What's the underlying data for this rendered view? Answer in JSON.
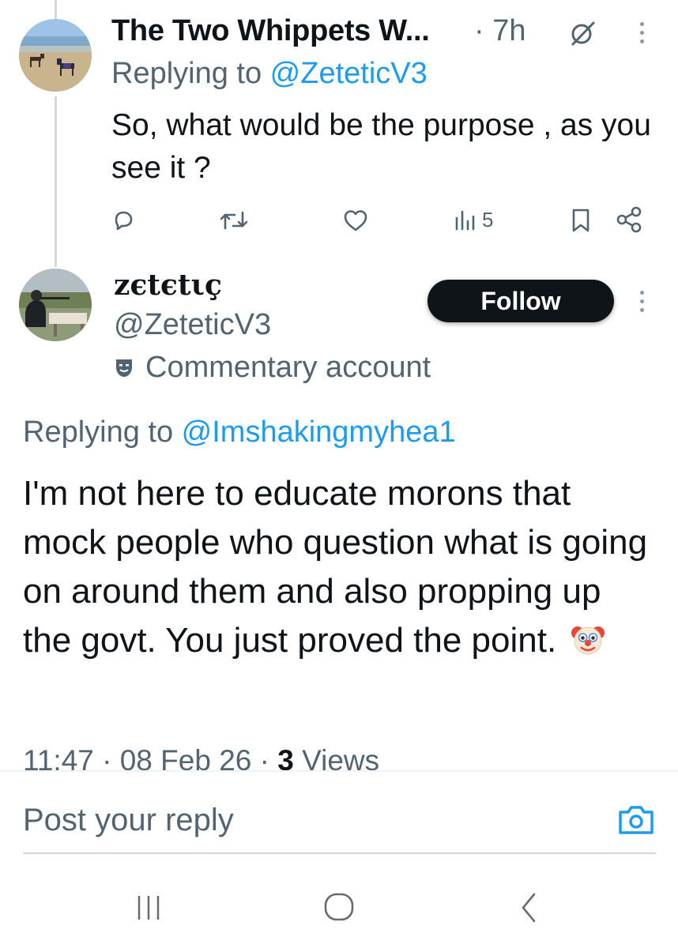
{
  "tweet1": {
    "author_name": "The Two Whippets W...",
    "time": "· 7h",
    "replying_prefix": "Replying to ",
    "replying_handle": "@ZeteticV3",
    "text": "So, what would be the purpose , as you see it ?",
    "views_count": "5"
  },
  "tweet2": {
    "author_name": "zєtєtιç",
    "handle": "@ZeteticV3",
    "follow_label": "Follow",
    "badge_label": "Commentary account",
    "replying_prefix": "Replying to ",
    "replying_handle": "@Imshakingmyhea1",
    "text": "I'm not here to educate morons that mock people who question what is going on around them and also propping up the govt. You just proved the point.",
    "emoji": "clown-face",
    "timestamp": "11:47 · 08 Feb 26 · ",
    "views_count": "3",
    "views_label": " Views"
  },
  "reply_box": {
    "placeholder": "Post your reply"
  },
  "colors": {
    "text_primary": "#0f1419",
    "text_secondary": "#536471",
    "link": "#1d9bf0",
    "follow_bg": "#0f1419"
  },
  "icons": [
    "reply-icon",
    "retweet-icon",
    "like-icon",
    "views-icon",
    "bookmark-icon",
    "share-icon",
    "grok-icon",
    "more-icon",
    "camera-icon",
    "recents-icon",
    "home-icon",
    "back-icon",
    "mask-icon"
  ]
}
